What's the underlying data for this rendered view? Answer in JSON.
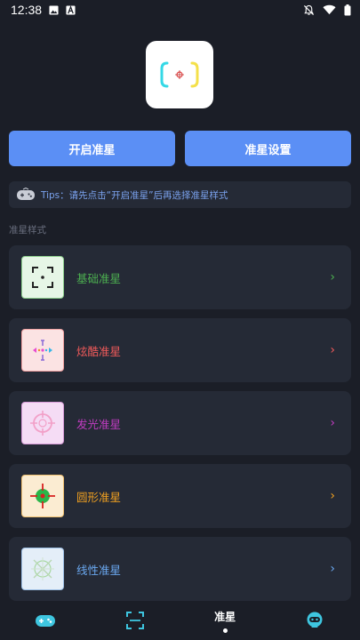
{
  "status_bar": {
    "time": "12:38",
    "icons": [
      "image-icon",
      "a-badge-icon",
      "notifications-off-icon",
      "wifi-icon",
      "battery-icon"
    ]
  },
  "buttons": {
    "start": "开启准星",
    "settings": "准星设置"
  },
  "tips": {
    "text": "Tips：请先点击“开启准星”后再选择准星样式"
  },
  "section": {
    "title": "准星样式"
  },
  "styles": [
    {
      "label": "基础准星",
      "color": "#4caf50",
      "thumb_bg": "#e6f6e6",
      "thumb_border": "#8ed08e",
      "icon": "basic-crosshair-icon"
    },
    {
      "label": "炫酷准星",
      "color": "#f05a5a",
      "thumb_bg": "#fbe3e3",
      "thumb_border": "#f1a1a1",
      "icon": "cool-crosshair-icon"
    },
    {
      "label": "发光准星",
      "color": "#c03cc0",
      "thumb_bg": "#f5dcf5",
      "thumb_border": "#d79ad7",
      "icon": "glow-crosshair-icon"
    },
    {
      "label": "圆形准星",
      "color": "#f0a020",
      "thumb_bg": "#fbecd2",
      "thumb_border": "#f0c070",
      "icon": "round-crosshair-icon"
    },
    {
      "label": "线性准星",
      "color": "#6aa8f0",
      "thumb_bg": "#e4eef8",
      "thumb_border": "#9ec0e6",
      "icon": "linear-crosshair-icon"
    }
  ],
  "nav": {
    "active_label": "准星",
    "items": [
      "gamepad-icon",
      "scan-icon",
      "crosshair-tab",
      "robot-icon"
    ]
  }
}
